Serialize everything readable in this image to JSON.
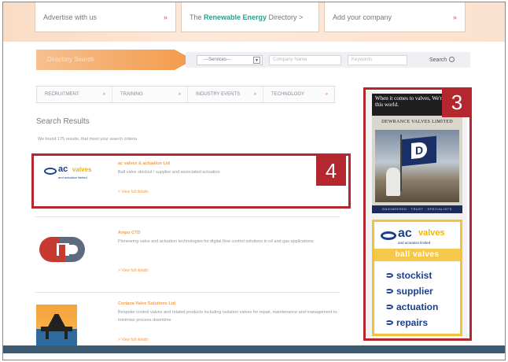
{
  "top_links": {
    "advertise": "Advertise with us",
    "directory_prefix": "The ",
    "directory_brand": "Renewable Energy",
    "directory_suffix": " Directory >",
    "add_company": "Add your company",
    "arrow": "»"
  },
  "search": {
    "pill_label": "Directory Search",
    "services_value": "---Services---",
    "company_placeholder": "Company Name",
    "keywords_placeholder": "Keywords",
    "button_label": "Search"
  },
  "tabs": [
    "RECRUITMENT",
    "TRAINING",
    "INDUSTRY EVENTS",
    "TECHNOLOGY"
  ],
  "tab_chevron": "»",
  "results": {
    "title": "Search Results",
    "found_text": "We found 175 results, that meet your search criteria",
    "items": [
      {
        "name": "ac valves & actuation Ltd",
        "description": "Ball valve stockist / supplier and associated actuation",
        "link": "> View full details"
      },
      {
        "name": "Ampo CTD",
        "description": "Pioneering valve and actuation technologies for digital flow control solutions in oil and gas applications",
        "link": "> View full details"
      },
      {
        "name": "Cortana Valve Solutions Ltd",
        "description": "Bespoke control valves and related products including isolation valves for repair, maintenance and management to minimise process downtime",
        "link": "> View full details"
      }
    ]
  },
  "ads": {
    "dewrance": {
      "headline": "When it comes to valves, We're out of this world.",
      "company": "DEWRANCE VALVES LIMITED",
      "footer": "ENGINEERED · TRUST · SPECIALISTS",
      "flag_letter": "D"
    },
    "ac_valves": {
      "logo_a": "ac",
      "logo_b": "valves",
      "logo_tag": "and actuation limited",
      "band": "ball valves",
      "items": [
        "stockist",
        "supplier",
        "actuation",
        "repairs"
      ]
    }
  },
  "small_logo": {
    "a": "ac",
    "b": "valves",
    "tag": "and actuation limited"
  },
  "highlights": {
    "sidebar_number": "3",
    "result_number": "4"
  },
  "colors": {
    "highlight": "#b4272f",
    "brand_blue": "#1b3f8b",
    "accent_orange": "#f39a4a",
    "teal": "#2a9d8f"
  }
}
